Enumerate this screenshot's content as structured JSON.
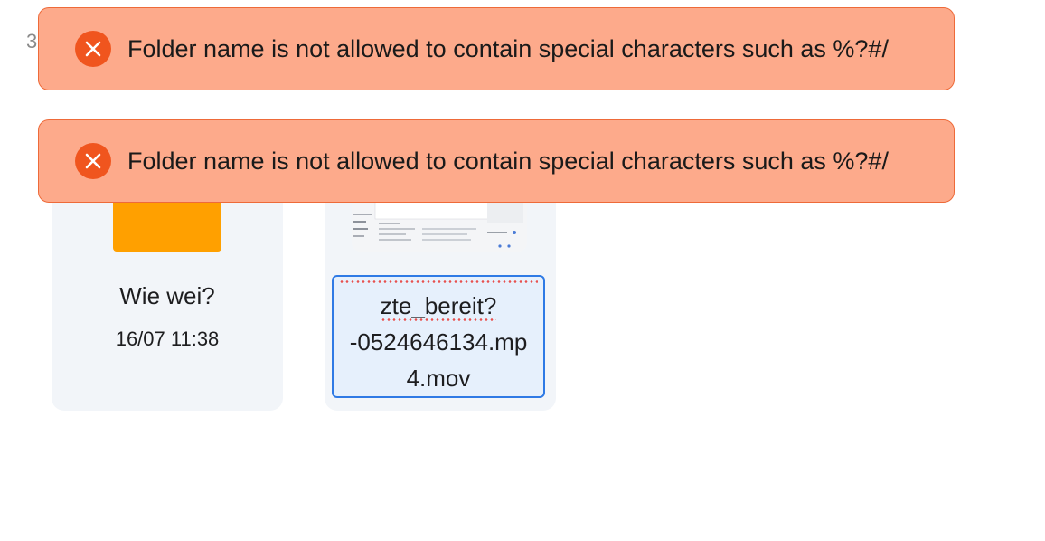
{
  "header": {
    "count_label": "3"
  },
  "items": [
    {
      "type": "folder",
      "name": "Wie wei?",
      "date": "16/07 11:38",
      "thumb_color": "#ffa000"
    },
    {
      "type": "video",
      "rename_lines": [
        "zte_bereit?",
        "-0524646134.mp",
        "4.mov"
      ]
    }
  ],
  "toasts": [
    {
      "icon": "error-circle-icon",
      "message": "Folder name is not allowed to contain special characters such as %?#/"
    },
    {
      "icon": "error-circle-icon",
      "message": "Folder name is not allowed to contain special characters such as %?#/"
    }
  ],
  "colors": {
    "toast_bg": "#fdaa8b",
    "toast_border": "#ee6a39",
    "error_icon": "#f0551e",
    "card_bg": "#f2f5f9",
    "edit_border": "#2f7ae5",
    "edit_bg": "#e6f0fc",
    "folder": "#ffa000"
  }
}
